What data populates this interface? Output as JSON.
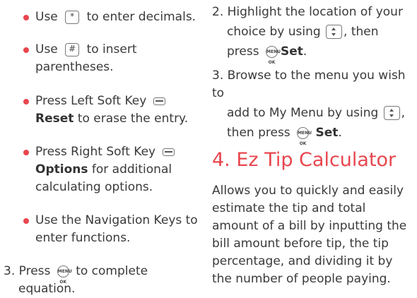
{
  "left": {
    "b1": {
      "pre": "Use",
      "key": "*",
      "post": "to enter decimals."
    },
    "b2": {
      "pre": "Use",
      "key": "#",
      "post": "to insert",
      "line2": "parentheses."
    },
    "b3": {
      "pre": "Press Left Soft Key",
      "bold": "Reset",
      "post": "to erase the entry."
    },
    "b4": {
      "pre": "Press Right Soft Key",
      "bold": "Options",
      "post": "for additional",
      "line3": "calculating options."
    },
    "b5": {
      "line1": "Use the Navigation Keys to",
      "line2": "enter functions."
    },
    "step3": {
      "pre": "3. Press",
      "key": "MENU OK",
      "post": "to complete",
      "line2": "equation."
    }
  },
  "right": {
    "step2": {
      "line1": "2. Highlight the location of your",
      "pre": "choice by using",
      "post": ", then",
      "press": "press",
      "key": "MENU OK",
      "bold": "Set",
      "end": "."
    },
    "step3": {
      "line1": "3. Browse to the menu you wish to",
      "pre": "add to My Menu by using",
      "post": ",",
      "then": "then press",
      "key": "MENU OK",
      "bold": "Set",
      "end": "."
    },
    "heading": "4. Ez Tip Calculator",
    "para": [
      "Allows you to quickly and easily",
      "estimate the tip and total",
      "amount of a bill by inputting the",
      "bill amount before tip, the tip",
      "percentage, and dividing it by",
      "the number of people paying."
    ]
  },
  "colors": {
    "accent": "#e8464f",
    "text": "#3a3a3a"
  },
  "icons": [
    "star-key-icon",
    "pound-key-icon",
    "left-soft-key-icon",
    "right-soft-key-icon",
    "ok-menu-key-icon",
    "navigation-key-icon"
  ]
}
